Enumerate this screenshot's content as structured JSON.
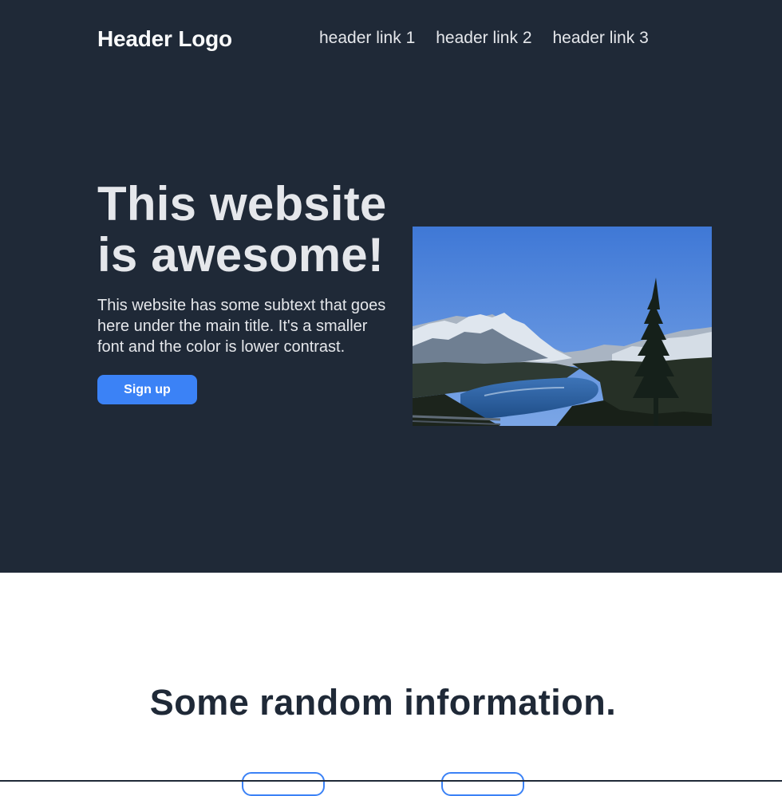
{
  "header": {
    "logo": "Header Logo",
    "links": [
      "header link 1",
      "header link 2",
      "header link 3"
    ]
  },
  "hero": {
    "title": "This website is awesome!",
    "subtext": "This website has some subtext that goes here under the main title. It's a smaller font and the color is lower contrast.",
    "button_label": "Sign up",
    "image_icon": "mountain-lake-photo"
  },
  "info": {
    "title": "Some random information."
  },
  "colors": {
    "hero_background": "#1f2937",
    "accent": "#3b82f6",
    "hero_text": "#e5e7eb",
    "page_background": "#ffffff"
  }
}
